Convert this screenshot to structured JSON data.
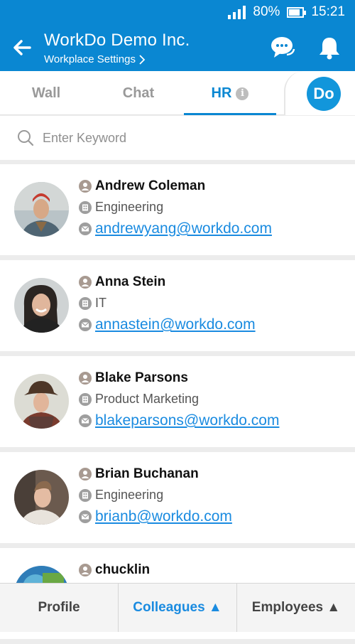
{
  "status_bar": {
    "battery": "80%",
    "battery_level": 0.8,
    "time": "15:21"
  },
  "header": {
    "title": "WorkDo Demo Inc.",
    "subtitle": "Workplace Settings"
  },
  "tabs": [
    {
      "label": "Wall"
    },
    {
      "label": "Chat"
    },
    {
      "label": "HR",
      "active": true
    }
  ],
  "do_button": "Do",
  "search": {
    "placeholder": "Enter Keyword"
  },
  "employees": [
    {
      "name": "Andrew Coleman",
      "department": "Engineering",
      "email": "andrewyang@workdo.com"
    },
    {
      "name": "Anna Stein",
      "department": "IT",
      "email": "annastein@workdo.com"
    },
    {
      "name": "Blake Parsons",
      "department": "Product Marketing",
      "email": "blakeparsons@workdo.com"
    },
    {
      "name": "Brian Buchanan",
      "department": "Engineering",
      "email": "brianb@workdo.com"
    },
    {
      "name": "chucklin",
      "department": "",
      "email": ""
    }
  ],
  "bottom_nav": [
    {
      "label": "Profile"
    },
    {
      "label": "Colleagues ▲",
      "active": true
    },
    {
      "label": "Employees ▲"
    }
  ],
  "colors": {
    "primary": "#0a87d2",
    "link": "#1a8be0",
    "accent_do": "#1296db"
  },
  "icons": {
    "back": "arrow-left-icon",
    "chat": "chat-bubble-icon",
    "bell": "bell-icon",
    "search": "search-icon",
    "person": "person-icon",
    "department": "building-icon",
    "email": "mail-icon",
    "info": "info-icon",
    "signal": "signal-icon",
    "battery": "battery-icon"
  }
}
